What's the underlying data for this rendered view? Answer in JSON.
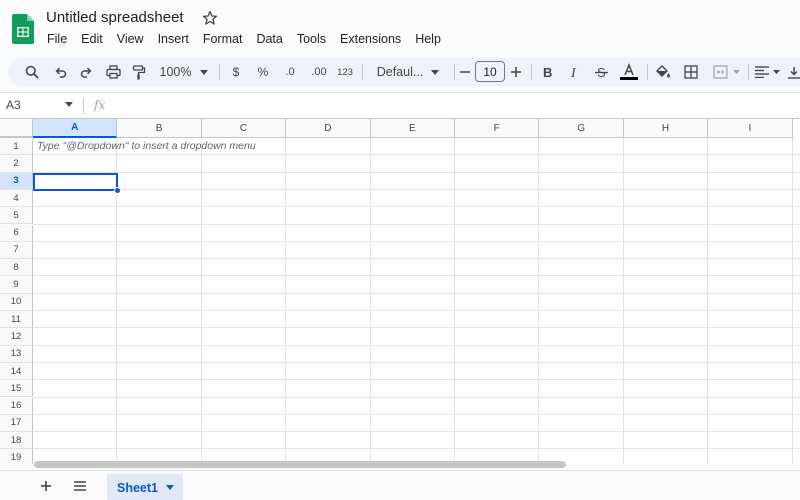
{
  "app": {
    "title": "Untitled spreadsheet"
  },
  "menu": [
    "File",
    "Edit",
    "View",
    "Insert",
    "Format",
    "Data",
    "Tools",
    "Extensions",
    "Help"
  ],
  "toolbar": {
    "zoom": "100%",
    "currency_symbol": "$",
    "percent_symbol": "%",
    "decrease_decimal": ".0",
    "increase_decimal": ".00",
    "more_formats": "123",
    "font_name": "Defaul...",
    "font_size": "10",
    "icons": [
      "search-icon",
      "undo-icon",
      "redo-icon",
      "print-icon",
      "paint-format-icon",
      "bold-icon",
      "italic-icon",
      "strikethrough-icon",
      "text-color-icon",
      "fill-color-icon",
      "borders-icon",
      "merge-cells-icon",
      "align-left-icon"
    ]
  },
  "formula_bar": {
    "name_box": "A3",
    "fx_label": "fx"
  },
  "grid": {
    "columns": [
      "A",
      "B",
      "C",
      "D",
      "E",
      "F",
      "G",
      "H",
      "I"
    ],
    "rows": [
      "1",
      "2",
      "3",
      "4",
      "5",
      "6",
      "7",
      "8",
      "9",
      "10",
      "11",
      "12",
      "13",
      "14",
      "15",
      "16",
      "17",
      "18",
      "19"
    ],
    "selected_column": "A",
    "selected_row": "3",
    "hint": "Type \"@Dropdown\"  to insert a dropdown menu"
  },
  "bottom": {
    "sheet_tab": "Sheet1"
  },
  "colors": {
    "accent": "#0b57d0",
    "logo_green": "#0f9d58",
    "toolbar_bg": "#edf2fa"
  }
}
